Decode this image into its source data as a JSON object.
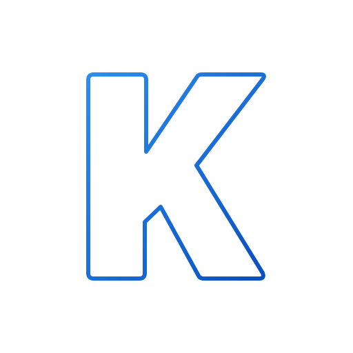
{
  "logo": {
    "letter": "K",
    "icon": "letter-k-outline-icon",
    "colors": {
      "background": "#ffffff",
      "gradient_start": "#2b8ef0",
      "gradient_end": "#0a4fbf"
    }
  }
}
